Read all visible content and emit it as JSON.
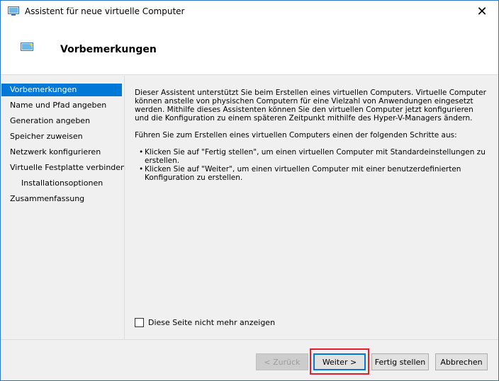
{
  "window": {
    "title": "Assistent für neue virtuelle Computer",
    "close_glyph": "✕"
  },
  "header": {
    "title": "Vorbemerkungen"
  },
  "nav": {
    "items": [
      {
        "label": "Vorbemerkungen"
      },
      {
        "label": "Name und Pfad angeben"
      },
      {
        "label": "Generation angeben"
      },
      {
        "label": "Speicher zuweisen"
      },
      {
        "label": "Netzwerk konfigurieren"
      },
      {
        "label": "Virtuelle Festplatte verbinden"
      },
      {
        "label": "Installationsoptionen"
      },
      {
        "label": "Zusammenfassung"
      }
    ]
  },
  "content": {
    "intro": "Dieser Assistent unterstützt Sie beim Erstellen eines virtuellen Computers. Virtuelle Computer können anstelle von physischen Computern für eine Vielzahl von Anwendungen eingesetzt werden. Mithilfe dieses Assistenten können Sie den virtuellen Computer jetzt konfigurieren und die Konfiguration zu einem späteren Zeitpunkt mithilfe des Hyper-V-Managers ändern.",
    "steps_intro": "Führen Sie zum Erstellen eines virtuellen Computers einen der folgenden Schritte aus:",
    "bullets": [
      "Klicken Sie auf \"Fertig stellen\", um einen virtuellen Computer mit Standardeinstellungen zu erstellen.",
      "Klicken Sie auf \"Weiter\", um einen virtuellen Computer mit einer benutzerdefinierten Konfiguration zu erstellen."
    ]
  },
  "checkbox": {
    "label": "Diese Seite nicht mehr anzeigen",
    "checked": false
  },
  "buttons": {
    "back": "< Zurück",
    "next": "Weiter >",
    "finish": "Fertig stellen",
    "cancel": "Abbrechen"
  },
  "colors": {
    "accent": "#0078d7",
    "highlight": "#e0202a"
  }
}
